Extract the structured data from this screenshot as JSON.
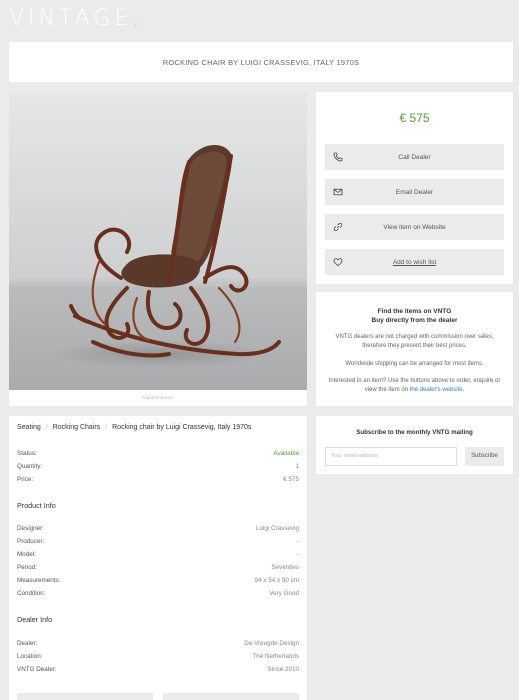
{
  "logo": {
    "text": "VINTAGE",
    "dot": "."
  },
  "title": "ROCKING CHAIR BY LUIGI CRASSEVIG, ITALY 1970S",
  "photo": {
    "caption": "Report this item"
  },
  "price": "€ 575",
  "actions": [
    {
      "label": "Call Dealer",
      "icon": "phone-icon"
    },
    {
      "label": "Email Dealer",
      "icon": "envelope-icon"
    },
    {
      "label": "View item on Website",
      "icon": "link-icon"
    },
    {
      "label": "Add to wish list",
      "icon": "heart-icon"
    }
  ],
  "info": {
    "heading1": "Find the items on VNTG",
    "heading2": "Buy directly from the dealer",
    "p1": "VNTG dealers are not charged with commission over sales, therefore they present their best prices.",
    "p2": "Worldwide shipping can be arranged for most items.",
    "p3_prefix": "Interested in an item? Use the buttons above to order, enquire or view the item on ",
    "p3_link": "the dealer's website",
    "p3_suffix": "."
  },
  "subscribe": {
    "title": "Subscribe to the monthly VNTG mailing",
    "placeholder": "Your email address",
    "button": "Subscribe"
  },
  "breadcrumb": [
    "Seating",
    "Rocking Chairs",
    "Rocking chair by Luigi Crassevig, Italy 1970s"
  ],
  "status": [
    {
      "k": "Status:",
      "v": "Available"
    },
    {
      "k": "Quantity:",
      "v": "1"
    },
    {
      "k": "Price:",
      "v": "€ 575"
    }
  ],
  "product_info": {
    "heading": "Product Info",
    "rows": [
      {
        "k": "Designer:",
        "v": "Luigi Crassevig"
      },
      {
        "k": "Producer:",
        "v": "-"
      },
      {
        "k": "Model:",
        "v": "-"
      },
      {
        "k": "Period:",
        "v": "Seventies"
      },
      {
        "k": "Measurements:",
        "v": "94 x 54 x 90 cm"
      },
      {
        "k": "Condition:",
        "v": "Very Good"
      }
    ]
  },
  "dealer_info": {
    "heading": "Dealer Info",
    "rows": [
      {
        "k": "Dealer:",
        "v": "De Vreugde Design"
      },
      {
        "k": "Location:",
        "v": "The Netherlands"
      },
      {
        "k": "VNTG Dealer:",
        "v": "Since 2010"
      }
    ]
  },
  "colors": {
    "accent": "#5a9a3c",
    "link": "#3a7bbf",
    "background": "#ebebeb",
    "logo_dot": "#d4c23a"
  }
}
